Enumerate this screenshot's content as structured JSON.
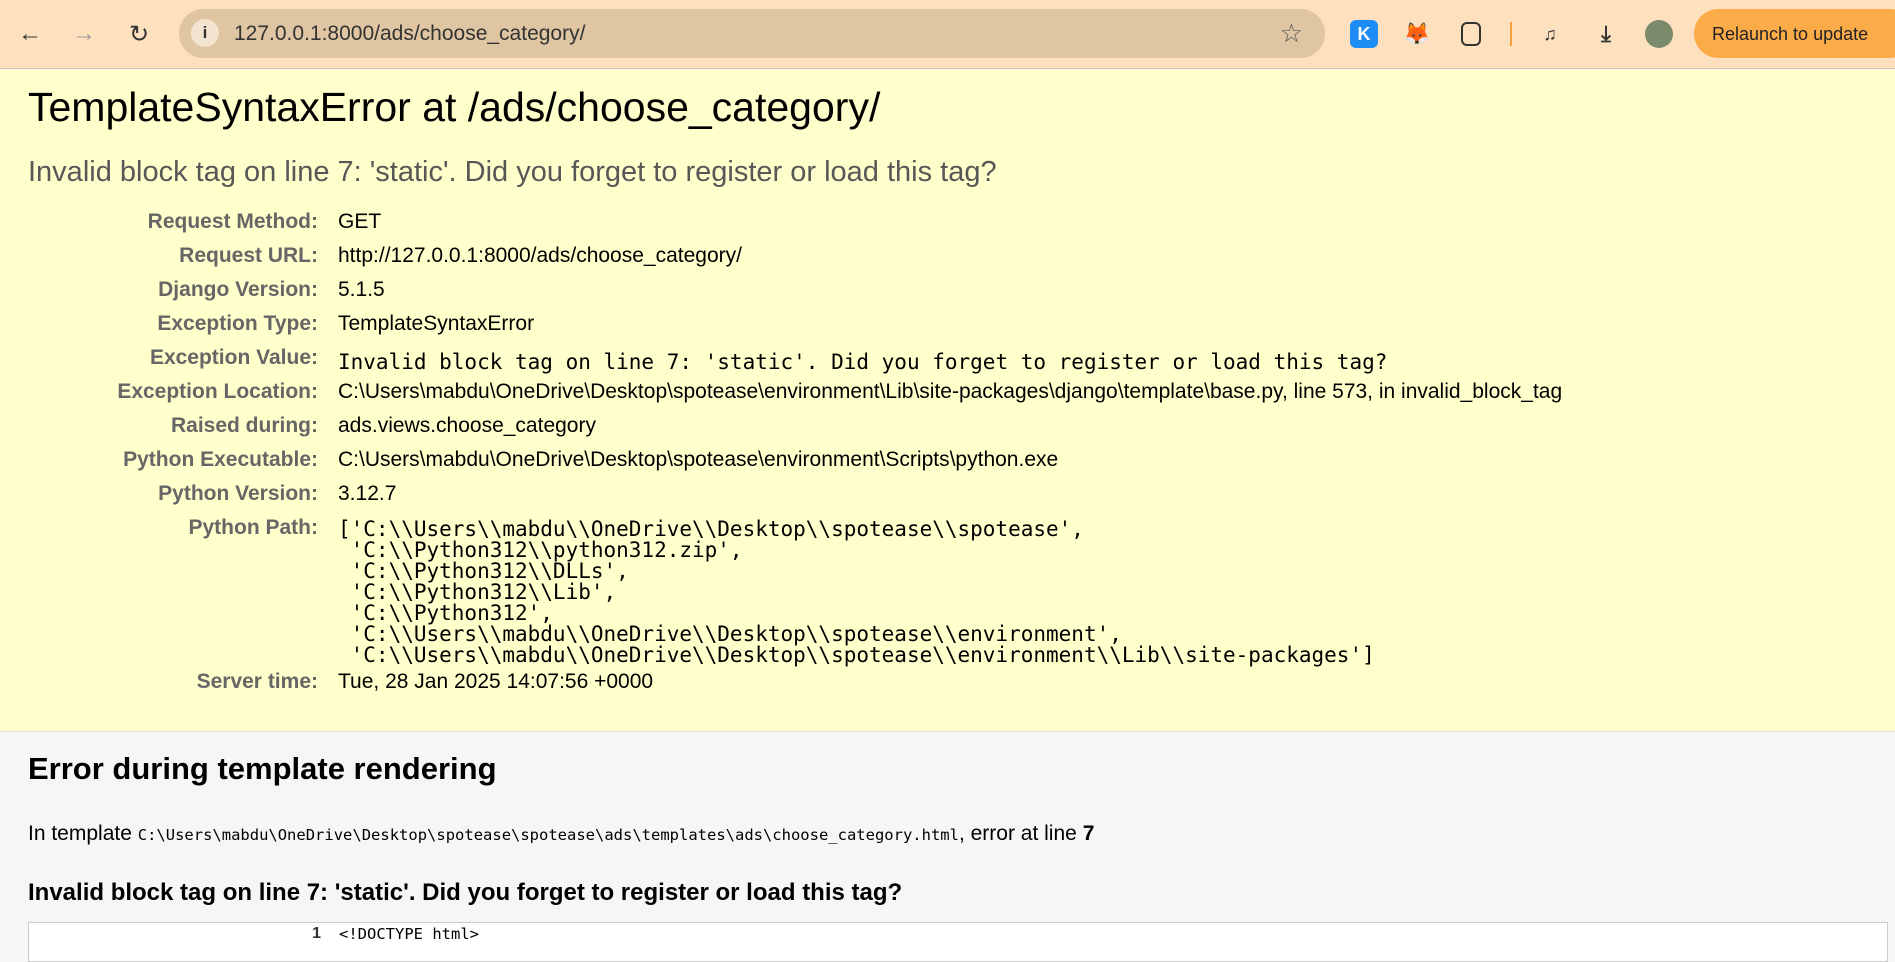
{
  "browser": {
    "url": "127.0.0.1:8000/ads/choose_category/",
    "relaunch_label": "Relaunch to update",
    "extensions": [
      "kami-icon",
      "metamask-icon",
      "puzzle-icon"
    ]
  },
  "error": {
    "title": "TemplateSyntaxError at /ads/choose_category/",
    "subtitle": "Invalid block tag on line 7: 'static'. Did you forget to register or load this tag?",
    "meta": [
      {
        "label": "Request Method:",
        "value": "GET"
      },
      {
        "label": "Request URL:",
        "value": "http://127.0.0.1:8000/ads/choose_category/"
      },
      {
        "label": "Django Version:",
        "value": "5.1.5"
      },
      {
        "label": "Exception Type:",
        "value": "TemplateSyntaxError"
      },
      {
        "label": "Exception Value:",
        "value": "Invalid block tag on line 7: 'static'. Did you forget to register or load this tag?"
      },
      {
        "label": "Exception Location:",
        "value": "C:\\Users\\mabdu\\OneDrive\\Desktop\\spotease\\environment\\Lib\\site-packages\\django\\template\\base.py, line 573, in invalid_block_tag"
      },
      {
        "label": "Raised during:",
        "value": "ads.views.choose_category"
      },
      {
        "label": "Python Executable:",
        "value": "C:\\Users\\mabdu\\OneDrive\\Desktop\\spotease\\environment\\Scripts\\python.exe"
      },
      {
        "label": "Python Version:",
        "value": "3.12.7"
      },
      {
        "label": "Python Path:",
        "value": "['C:\\\\Users\\\\mabdu\\\\OneDrive\\\\Desktop\\\\spotease\\\\spotease',\n 'C:\\\\Python312\\\\python312.zip',\n 'C:\\\\Python312\\\\DLLs',\n 'C:\\\\Python312\\\\Lib',\n 'C:\\\\Python312',\n 'C:\\\\Users\\\\mabdu\\\\OneDrive\\\\Desktop\\\\spotease\\\\environment',\n 'C:\\\\Users\\\\mabdu\\\\OneDrive\\\\Desktop\\\\spotease\\\\environment\\\\Lib\\\\site-packages']"
      },
      {
        "label": "Server time:",
        "value": "Tue, 28 Jan 2025 14:07:56 +0000"
      }
    ]
  },
  "template": {
    "heading": "Error during template rendering",
    "in_template": "In template",
    "path": "C:\\Users\\mabdu\\OneDrive\\Desktop\\spotease\\spotease\\ads\\templates\\ads\\choose_category.html",
    "error_at": ", error at line",
    "line": "7",
    "message": "Invalid block tag on line 7: 'static'. Did you forget to register or load this tag?",
    "code": [
      {
        "num": "1",
        "text": "<!DOCTYPE html>"
      }
    ]
  }
}
